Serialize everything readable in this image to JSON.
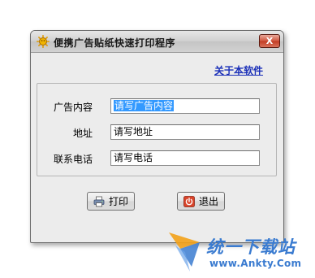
{
  "window": {
    "title": "便携广告贴纸快速打印程序",
    "close_label": "X"
  },
  "about_link": "关于本软件",
  "form": {
    "fields": [
      {
        "label": "广告内容",
        "value": "请写广告内容",
        "selected": true
      },
      {
        "label": "地址",
        "value": "请写地址",
        "selected": false
      },
      {
        "label": "联系电话",
        "value": "请写电话",
        "selected": false
      }
    ]
  },
  "buttons": {
    "print": "打印",
    "exit": "退出"
  },
  "watermark": {
    "name": "统一下载站",
    "url": "www.Ankty.Com"
  },
  "colors": {
    "link": "#1a2fb8",
    "selection": "#3399ff",
    "close": "#c33b22",
    "watermark": "#3a7bd0"
  },
  "icons": {
    "app": "sun-icon",
    "print": "printer-icon",
    "exit": "power-icon"
  }
}
